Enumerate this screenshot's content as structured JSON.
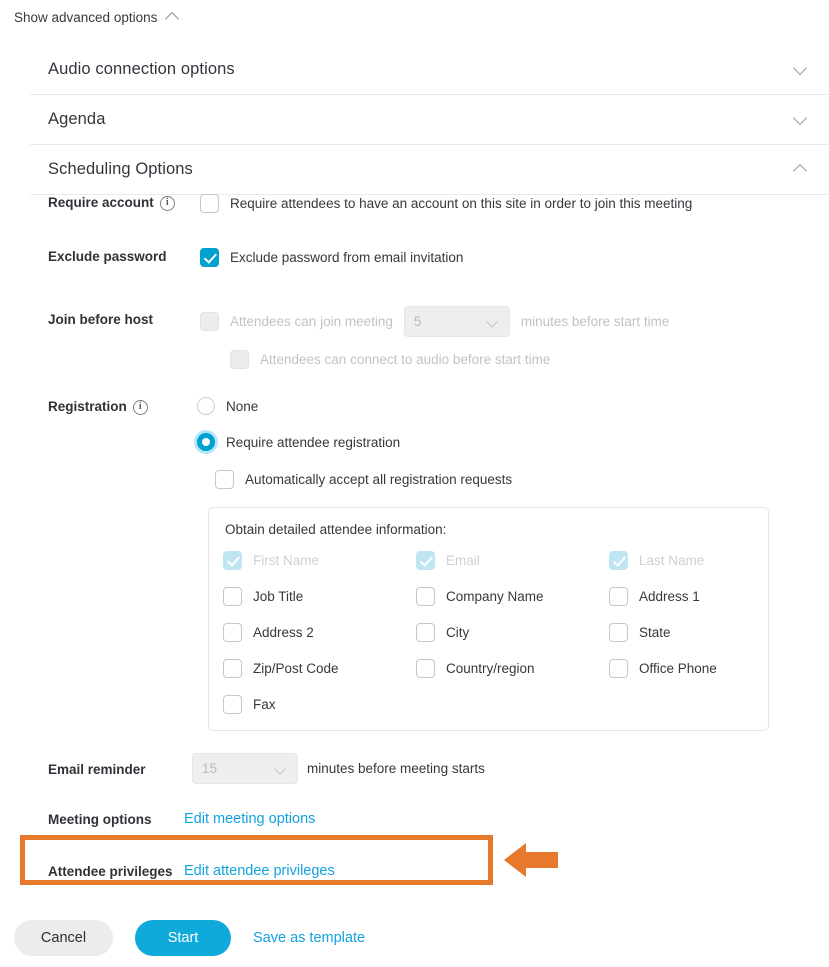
{
  "advanced": {
    "label": "Show advanced options",
    "chevron": "chevron-up-icon"
  },
  "accordion": [
    {
      "title": "Audio connection options",
      "chevron": "chevron-down-icon",
      "expanded": false
    },
    {
      "title": "Agenda",
      "chevron": "chevron-down-icon",
      "expanded": false
    },
    {
      "title": "Scheduling Options",
      "chevron": "chevron-up-icon",
      "expanded": true
    }
  ],
  "require_account": {
    "label": "Require account",
    "info": "info-icon",
    "checkbox_label": "Require attendees to have an account on this site in order to join this meeting",
    "checked": false
  },
  "exclude_password": {
    "label": "Exclude password",
    "checkbox_label": "Exclude password from email invitation",
    "checked": true
  },
  "join_before_host": {
    "label": "Join before host",
    "option1_prefix": "Attendees can join meeting",
    "select_value": "5",
    "option1_suffix": "minutes before start time",
    "option2": "Attendees can connect to audio before start time",
    "disabled": true
  },
  "registration": {
    "label": "Registration",
    "info": "info-icon",
    "options": [
      {
        "label": "None",
        "selected": false
      },
      {
        "label": "Require attendee registration",
        "selected": true
      }
    ],
    "auto_accept": {
      "label": "Automatically accept all registration requests",
      "checked": false
    },
    "infobox": {
      "title": "Obtain detailed attendee information:",
      "fields": [
        {
          "label": "First Name",
          "checked": true,
          "disabled": true
        },
        {
          "label": "Email",
          "checked": true,
          "disabled": true
        },
        {
          "label": "Last Name",
          "checked": true,
          "disabled": true
        },
        {
          "label": "Job Title",
          "checked": false,
          "disabled": false
        },
        {
          "label": "Company Name",
          "checked": false,
          "disabled": false
        },
        {
          "label": "Address 1",
          "checked": false,
          "disabled": false
        },
        {
          "label": "Address 2",
          "checked": false,
          "disabled": false
        },
        {
          "label": "City",
          "checked": false,
          "disabled": false
        },
        {
          "label": "State",
          "checked": false,
          "disabled": false
        },
        {
          "label": "Zip/Post Code",
          "checked": false,
          "disabled": false
        },
        {
          "label": "Country/region",
          "checked": false,
          "disabled": false
        },
        {
          "label": "Office Phone",
          "checked": false,
          "disabled": false
        },
        {
          "label": "Fax",
          "checked": false,
          "disabled": false
        }
      ]
    }
  },
  "email_reminder": {
    "label": "Email reminder",
    "select_value": "15",
    "suffix": "minutes before meeting starts",
    "disabled": true
  },
  "meeting_options": {
    "label": "Meeting options",
    "link": "Edit meeting options"
  },
  "attendee_privileges": {
    "label": "Attendee privileges",
    "link": "Edit attendee privileges",
    "highlighted": true
  },
  "footer": {
    "cancel": "Cancel",
    "start": "Start",
    "save_template": "Save as template"
  },
  "colors": {
    "accent_blue": "#00a0d1",
    "link_blue": "#11a2e0",
    "highlight_orange": "#e8792c",
    "disabled_grey": "#c0c3c6"
  }
}
